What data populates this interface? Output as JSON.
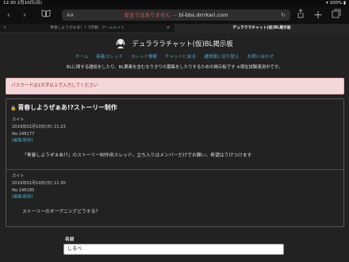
{
  "statusbar": {
    "time": "12:30",
    "date": "2月10日(日)",
    "battery": "100%"
  },
  "toolbar": {
    "back_icon": "chevron-left",
    "forward_icon": "chevron-right",
    "bookmarks_icon": "book",
    "url_prefix": "AA",
    "url_warning": "安全ではありません — ",
    "url_domain": "bl-bbs.drrrkari.com",
    "reload_icon": "reload",
    "share_icon": "share",
    "new_tab_icon": "plus",
    "tabs_icon": "tabs"
  },
  "tabs": [
    {
      "label": "青春しようぜぁあ！？3学期：ゲームエイト",
      "active": false
    },
    {
      "label": "デュラララチャット(仮)BL掲示板",
      "active": true
    }
  ],
  "header": {
    "site_title": "デュラララチャット(仮)BL掲示板"
  },
  "nav": [
    "ホーム",
    "新着スレッド",
    "スレッド検索",
    "チャットに戻る",
    "通常版に切り替え",
    "お問い合わせ"
  ],
  "description": "BLに関する雑談をしたり、BL要素を含むなりきりの募集をしたりするための掲示板です ※現在試験運用中です。",
  "alert": "パスワードは1文字以上で入力してください",
  "thread": {
    "title": "青春しようぜぁあ!?ストーリー制作",
    "posts": [
      {
        "author": "カイト",
        "datetime": "2019年02月10日(日) 11:23",
        "number": "No.146177",
        "edit_label": "[編集/削除]",
        "message": "「青春しようぜぁあ!?」のストーリー制作用スレッド。立ち入りはメンバーだけでお願い。希望はうけつけます"
      },
      {
        "author": "カイト",
        "datetime": "2019年02月10日(日) 11:30",
        "number": "No.146185",
        "edit_label": "[編集/削除]",
        "message": "ストーリーのオープニングどうする？"
      }
    ]
  },
  "form": {
    "name_label": "名前",
    "name_value": "しるべ"
  }
}
